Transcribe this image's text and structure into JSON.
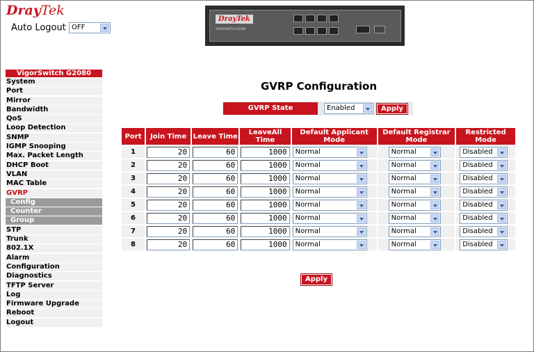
{
  "brand": {
    "name_a": "Dray",
    "name_b": "Tek"
  },
  "auto_logout": {
    "label": "Auto Logout",
    "value": "OFF"
  },
  "device": {
    "logo": "DrayTek",
    "model_text": "VIGORSWITCH G2080"
  },
  "sidebar": {
    "title": "VigorSwitch G2080",
    "items_top": [
      "System",
      "Port",
      "Mirror",
      "Bandwidth",
      "QoS",
      "Loop Detection",
      "SNMP",
      "IGMP Snooping",
      "Max. Packet Length",
      "DHCP Boot",
      "VLAN",
      "MAC Table",
      "GVRP"
    ],
    "subitems": [
      "Config",
      "Counter",
      "Group"
    ],
    "items_bottom": [
      "STP",
      "Trunk",
      "802.1X",
      "Alarm",
      "Configuration",
      "Diagnostics",
      "TFTP Server",
      "Log",
      "Firmware Upgrade",
      "Reboot",
      "Logout"
    ]
  },
  "page": {
    "title": "GVRP Configuration"
  },
  "gvrp_state": {
    "label": "GVRP State",
    "value": "Enabled",
    "apply_label": "Apply"
  },
  "table": {
    "headers": {
      "port": "Port",
      "join": "Join Time",
      "leave": "Leave Time",
      "leaveall": "LeaveAll Time",
      "applicant": "Default Applicant Mode",
      "registrar": "Default Registrar Mode",
      "restricted": "Restricted Mode"
    },
    "rows": [
      {
        "port": "1",
        "join": "20",
        "leave": "60",
        "leaveall": "1000",
        "applicant": "Normal",
        "registrar": "Normal",
        "restricted": "Disabled"
      },
      {
        "port": "2",
        "join": "20",
        "leave": "60",
        "leaveall": "1000",
        "applicant": "Normal",
        "registrar": "Normal",
        "restricted": "Disabled"
      },
      {
        "port": "3",
        "join": "20",
        "leave": "60",
        "leaveall": "1000",
        "applicant": "Normal",
        "registrar": "Normal",
        "restricted": "Disabled"
      },
      {
        "port": "4",
        "join": "20",
        "leave": "60",
        "leaveall": "1000",
        "applicant": "Normal",
        "registrar": "Normal",
        "restricted": "Disabled"
      },
      {
        "port": "5",
        "join": "20",
        "leave": "60",
        "leaveall": "1000",
        "applicant": "Normal",
        "registrar": "Normal",
        "restricted": "Disabled"
      },
      {
        "port": "6",
        "join": "20",
        "leave": "60",
        "leaveall": "1000",
        "applicant": "Normal",
        "registrar": "Normal",
        "restricted": "Disabled"
      },
      {
        "port": "7",
        "join": "20",
        "leave": "60",
        "leaveall": "1000",
        "applicant": "Normal",
        "registrar": "Normal",
        "restricted": "Disabled"
      },
      {
        "port": "8",
        "join": "20",
        "leave": "60",
        "leaveall": "1000",
        "applicant": "Normal",
        "registrar": "Normal",
        "restricted": "Disabled"
      }
    ]
  },
  "apply_label": "Apply",
  "colors": {
    "accent": "#c8141e",
    "menu_bg": "#f0f0f0",
    "submenu_bg": "#9a9a9a"
  }
}
